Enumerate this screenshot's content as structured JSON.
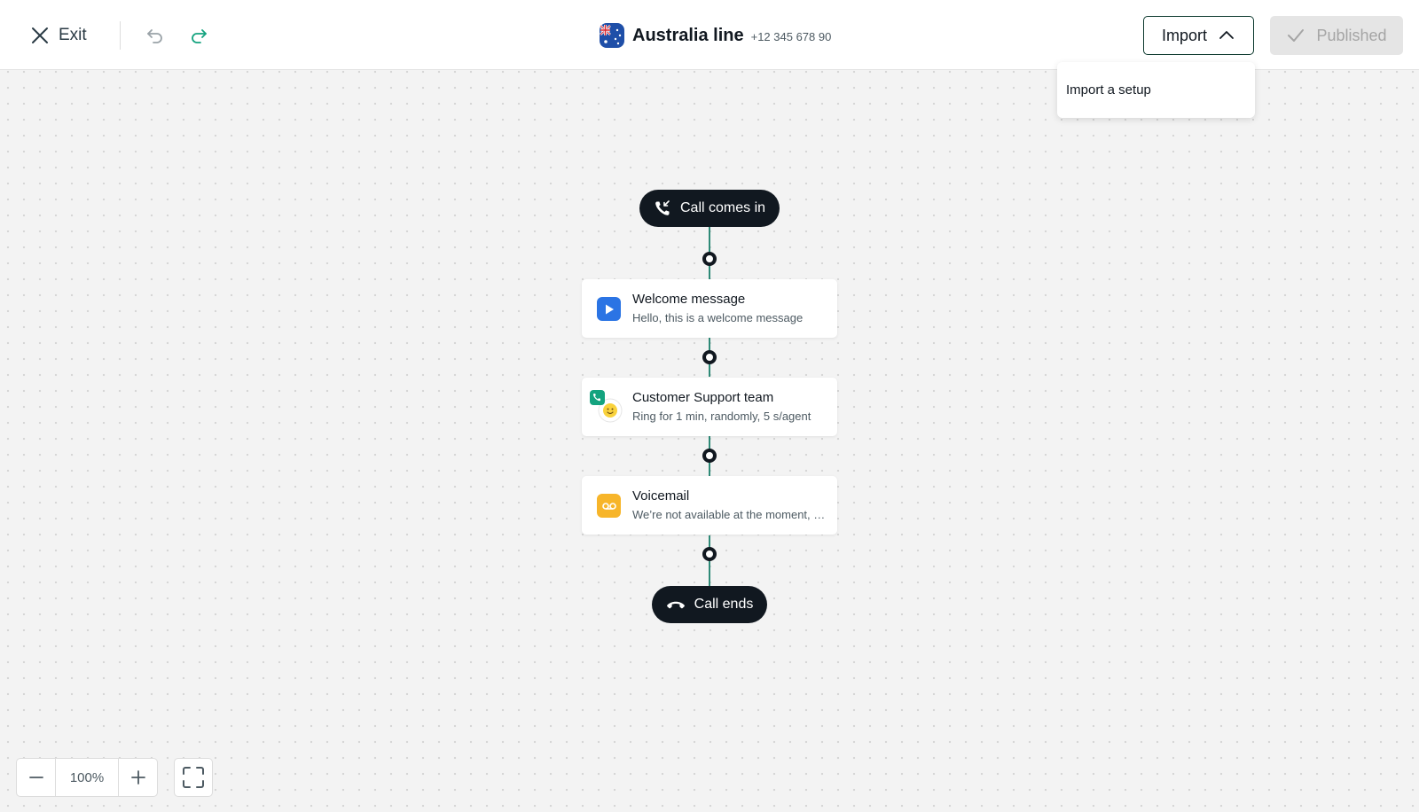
{
  "header": {
    "exit_label": "Exit",
    "line_title": "Australia line",
    "line_number": "+12 345 678 90",
    "import_label": "Import",
    "published_label": "Published"
  },
  "import_menu": {
    "items": [
      {
        "label": "Import a setup"
      }
    ]
  },
  "flow": {
    "start_label": "Call comes in",
    "end_label": "Call ends",
    "nodes": [
      {
        "title": "Welcome message",
        "description": "Hello, this is a welcome message",
        "icon": "play-icon",
        "color": "#2b74e4"
      },
      {
        "title": "Customer Support team",
        "description": "Ring for 1 min, randomly, 5 s/agent",
        "icon": "team-avatar-icon",
        "color": "#14a37f"
      },
      {
        "title": "Voicemail",
        "description": "We’re not available at the moment, please leave a message",
        "icon": "voicemail-icon",
        "color": "#f7b52a"
      }
    ]
  },
  "zoom": {
    "value": "100%"
  },
  "colors": {
    "accent": "#14a37f",
    "connector": "#2e8a77",
    "dark": "#111820",
    "published_bg": "#e5e5e5"
  }
}
